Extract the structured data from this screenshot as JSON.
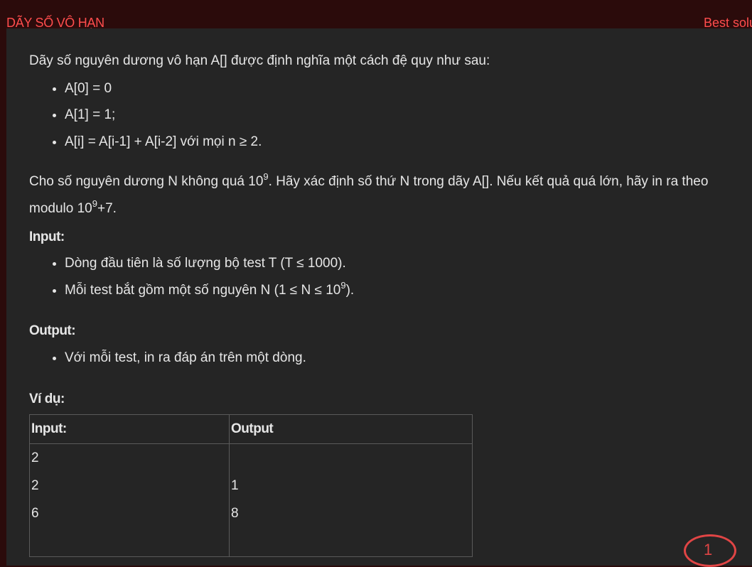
{
  "header": {
    "title": "DÃY SỐ VÔ HẠN",
    "best_link": "Best solu"
  },
  "problem": {
    "intro": "Dãy số nguyên dương vô hạn A[] được định nghĩa một cách đệ quy như sau:",
    "rules": [
      "A[0] = 0",
      "A[1] = 1;",
      "A[i] = A[i-1] + A[i-2] với mọi n ≥ 2."
    ],
    "statement_part1": "Cho số nguyên dương N không quá 10",
    "statement_exp1": "9",
    "statement_part2": ". Hãy xác định số thứ N trong dãy A[]. Nếu kết quả quá lớn, hãy in ra theo",
    "statement_line2_part1": "modulo 10",
    "statement_exp2": "9",
    "statement_line2_part2": "+7.",
    "input_heading": "Input:",
    "input_items": [
      "Dòng đầu tiên là số lượng bộ test T (T ≤ 1000).",
      "Mỗi test bắt gồm một số nguyên N (1 ≤ N ≤ 10"
    ],
    "input_exp": "9",
    "input_tail": ").",
    "output_heading": "Output:",
    "output_items": [
      "Với mỗi test, in ra đáp án trên một dòng."
    ],
    "example_heading": "Ví dụ:"
  },
  "example_table": {
    "headers": [
      "Input:",
      "Output"
    ],
    "input_lines": [
      "2",
      "2",
      "6"
    ],
    "output_lines": [
      "",
      "1",
      "8"
    ]
  },
  "annotation": {
    "number": "1",
    "color": "#e04545"
  },
  "colors": {
    "accent": "#ff4d4d",
    "background": "#252525",
    "frame": "#2b0b0b"
  }
}
